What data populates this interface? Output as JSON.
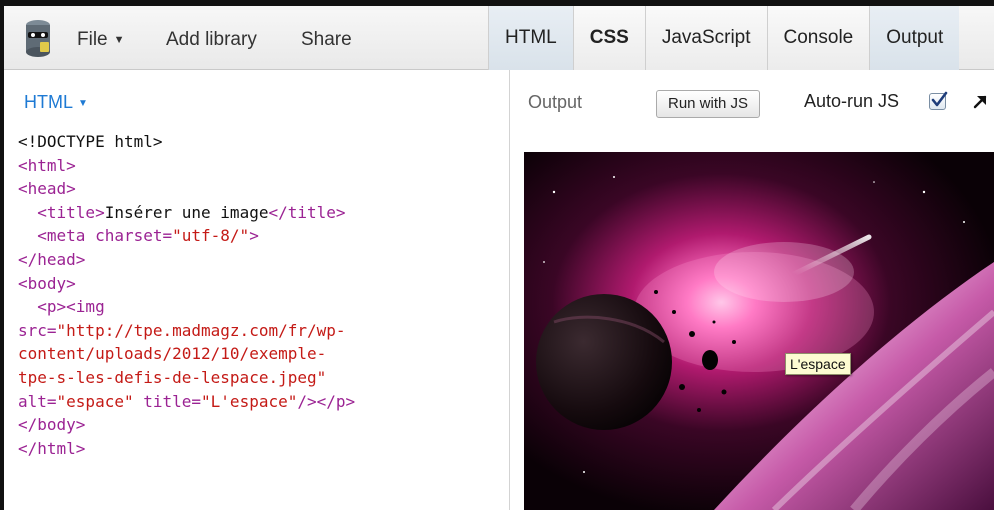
{
  "menu": {
    "file": "File",
    "add_library": "Add library",
    "share": "Share"
  },
  "tabs": [
    "HTML",
    "CSS",
    "JavaScript",
    "Console",
    "Output"
  ],
  "editor": {
    "language": "HTML",
    "code_lines": [
      [
        {
          "c": "tx",
          "s": "<!DOCTYPE html>"
        }
      ],
      [
        {
          "c": "t",
          "s": "<html>"
        }
      ],
      [
        {
          "c": "t",
          "s": "<head>"
        }
      ],
      [
        {
          "c": "tx",
          "s": "  "
        },
        {
          "c": "t",
          "s": "<title>"
        },
        {
          "c": "tx",
          "s": "Insérer une image"
        },
        {
          "c": "t",
          "s": "</title>"
        }
      ],
      [
        {
          "c": "tx",
          "s": "  "
        },
        {
          "c": "t",
          "s": "<meta "
        },
        {
          "c": "a",
          "s": "charset="
        },
        {
          "c": "v",
          "s": "\"utf-8/\""
        },
        {
          "c": "t",
          "s": ">"
        }
      ],
      [
        {
          "c": "t",
          "s": "</head>"
        }
      ],
      [
        {
          "c": "t",
          "s": "<body>"
        }
      ],
      [
        {
          "c": "tx",
          "s": "  "
        },
        {
          "c": "t",
          "s": "<p><img"
        }
      ],
      [
        {
          "c": "a",
          "s": "src="
        },
        {
          "c": "v",
          "s": "\"http://tpe.madmagz.com/fr/wp-"
        }
      ],
      [
        {
          "c": "v",
          "s": "content/uploads/2012/10/exemple-"
        }
      ],
      [
        {
          "c": "v",
          "s": "tpe-s-les-defis-de-lespace.jpeg\""
        }
      ],
      [
        {
          "c": "a",
          "s": "alt="
        },
        {
          "c": "v",
          "s": "\"espace\""
        },
        {
          "c": "tx",
          "s": " "
        },
        {
          "c": "a",
          "s": "title="
        },
        {
          "c": "v",
          "s": "\"L'espace\""
        },
        {
          "c": "t",
          "s": "/></p>"
        }
      ],
      [
        {
          "c": "t",
          "s": "</body>"
        }
      ],
      [
        {
          "c": "t",
          "s": "</html>"
        }
      ]
    ]
  },
  "output": {
    "label": "Output",
    "run_button": "Run with JS",
    "autorun_label": "Auto-run JS",
    "autorun_checked": true,
    "tooltip": "L'espace"
  },
  "icons": {
    "logo": "jsbin-logo-icon",
    "popout": "arrow-up-right-icon",
    "checkbox": "checkbox-checked-icon"
  },
  "colors": {
    "code_tag": "#9b2393",
    "code_value": "#c41a16",
    "html_link": "#1e7ad4"
  }
}
